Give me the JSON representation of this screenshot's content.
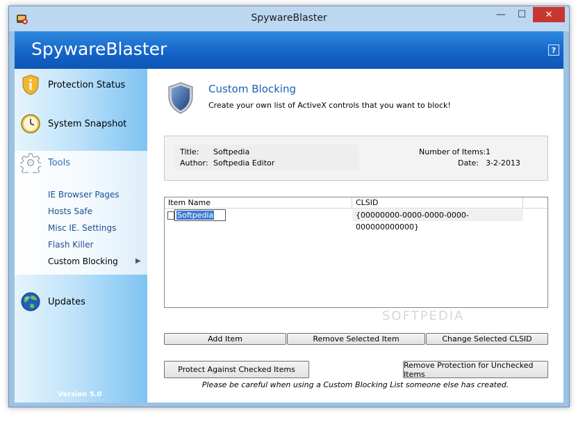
{
  "window": {
    "title": "SpywareBlaster",
    "min_glyph": "—",
    "max_glyph": "☐",
    "close_glyph": "✕"
  },
  "banner": {
    "title": "SpywareBlaster",
    "help_label": "?"
  },
  "sidebar": {
    "protection_status": "Protection Status",
    "system_snapshot": "System Snapshot",
    "tools": "Tools",
    "tool_items": [
      "IE Browser Pages",
      "Hosts Safe",
      "Misc IE. Settings",
      "Flash Killer",
      "Custom Blocking"
    ],
    "active_arrow": "▶",
    "updates": "Updates",
    "version": "Version 5.0"
  },
  "main": {
    "heading": "Custom Blocking",
    "subheading": "Create your own list of ActiveX controls that you want to block!",
    "info": {
      "title_label": "Title:",
      "title_value": "Softpedia",
      "author_label": "Author:",
      "author_value": "Softpedia Editor",
      "count_label": "Number of Items:",
      "count_value": "1",
      "date_label": "Date:",
      "date_value": "3-2-2013"
    },
    "list": {
      "columns": [
        "Item Name",
        "CLSID"
      ],
      "rows": [
        {
          "name": "Softpedia",
          "clsid": "{00000000-0000-0000-0000-000000000000}"
        }
      ]
    },
    "buttons": {
      "add": "Add Item",
      "remove": "Remove Selected Item",
      "change": "Change Selected CLSID",
      "protect": "Protect Against Checked Items",
      "unprotect": "Remove Protection for Unchecked Items"
    },
    "note": "Please be careful when using a Custom Blocking List someone else has created.",
    "watermark": "SOFTPEDIA"
  },
  "colors": {
    "accent": "#1a5fb4",
    "banner": "#1565c8",
    "close": "#c7372f"
  }
}
